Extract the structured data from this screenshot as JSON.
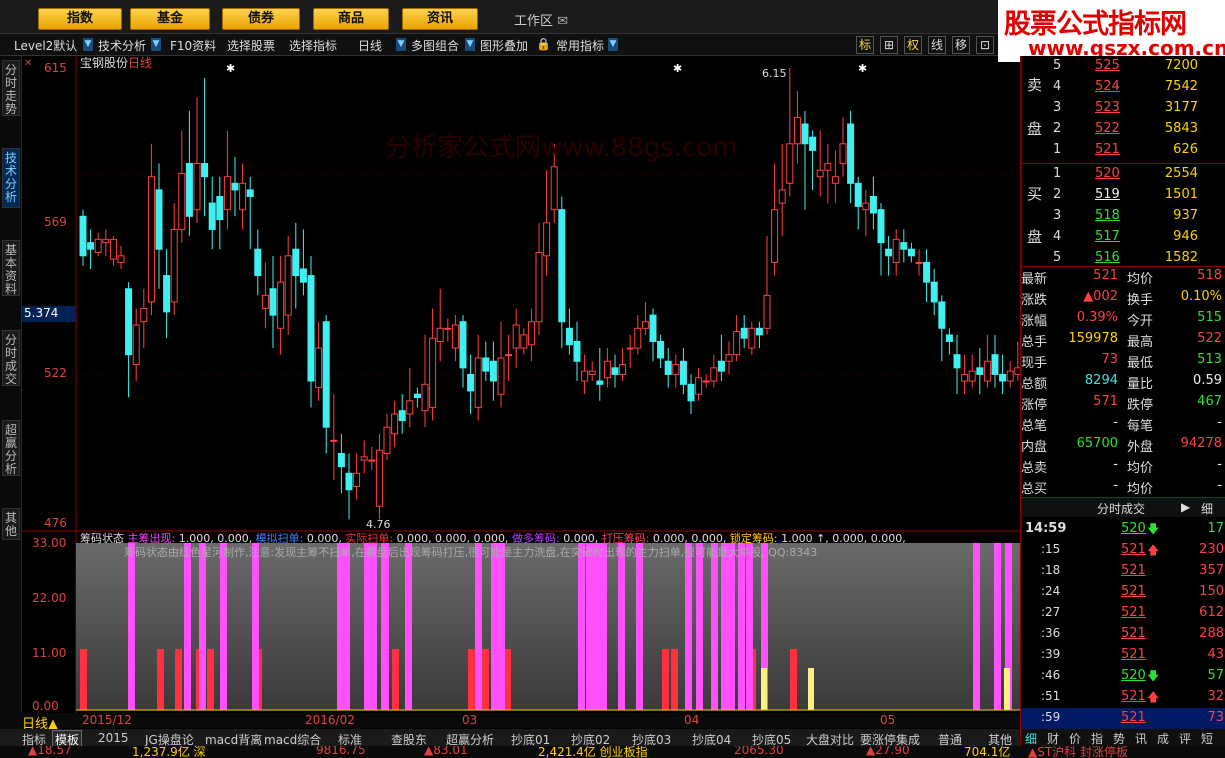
{
  "top_menu": [
    "指数",
    "基金",
    "债券",
    "商品",
    "资讯"
  ],
  "workarea_label": "工作区",
  "logo": {
    "title": "股票公式指标网",
    "url": "www.gszx.com.cn"
  },
  "toolbar": [
    "Level2默认",
    "技术分析",
    "F10资料",
    "选择股票",
    "选择指标",
    "日线",
    "多图组合",
    "图形叠加",
    "常用指标"
  ],
  "toolbar_right": [
    "标",
    "⊞",
    "权",
    "线",
    "移",
    "⊡"
  ],
  "left_tabs": [
    "分时走势",
    "技术分析",
    "基本资料",
    "分时成交",
    "超赢分析",
    "其他"
  ],
  "price_axis": {
    "ticks": [
      "615",
      "569",
      "522",
      "476"
    ],
    "current": "5.374"
  },
  "chart_title": {
    "name": "宝钢股份",
    "period": "日线"
  },
  "chart_annotations": {
    "high": "6.15",
    "low": "4.76"
  },
  "watermark": "分析家公式网www.88gs.com",
  "indicator": {
    "name": "筹码状态",
    "items": [
      {
        "label": "主筹出现:",
        "value": "1.000, 0.000,",
        "color": "#ff40ff"
      },
      {
        "label": "模拟扫单:",
        "value": "0.000,",
        "color": "#4080ff"
      },
      {
        "label": "实际扫单:",
        "value": "0.000, 0.000, 0.000,",
        "color": "#ff3030"
      },
      {
        "label": "做多筹码:",
        "value": "0.000,",
        "color": "#b040ff"
      },
      {
        "label": "打压筹码:",
        "value": "0.000, 0.000,",
        "color": "#ff4060"
      },
      {
        "label": "锁定筹码:",
        "value": "1.000 ↑, 0.000, 0.000,",
        "color": "#ffd000"
      }
    ],
    "scroll_text": "筹码状态由红色星河制作,注意:发现主筹不扫单,在横盘后出现筹码打压,很可能是主力洗盘,在突破时出现的主力扫单,很可能是大牛股, QQ:8343",
    "y_ticks": [
      "33.00",
      "22.00",
      "11.00",
      "0.00"
    ]
  },
  "period_label": "日线",
  "dates": [
    "2015/12",
    "2016/02",
    "03",
    "04",
    "05"
  ],
  "bottom_tabs": [
    "指标",
    "模板",
    "2015",
    "JG操盘论",
    "macd背离",
    "macd综合",
    "标准",
    "查股东",
    "超赢分析",
    "抄底01",
    "抄底02",
    "抄底03",
    "抄底04",
    "抄底05",
    "大盘对比",
    "要涨停集成",
    "普通",
    "其他"
  ],
  "status_bar": [
    "▲18.57",
    "1,237.9亿 深",
    "9816.75",
    "▲83.01",
    "2,421.4亿 创业板指",
    "2065.30",
    "▲27.90",
    "704.1亿",
    "▲ST沪科 封涨停板"
  ],
  "order_book": {
    "sell_label": [
      "卖",
      "盘"
    ],
    "buy_label": [
      "买",
      "盘"
    ],
    "sell": [
      {
        "level": "5",
        "price": "525",
        "vol": "7200"
      },
      {
        "level": "4",
        "price": "524",
        "vol": "7542"
      },
      {
        "level": "3",
        "price": "523",
        "vol": "3177"
      },
      {
        "level": "2",
        "price": "522",
        "vol": "5843"
      },
      {
        "level": "1",
        "price": "521",
        "vol": "626"
      }
    ],
    "buy": [
      {
        "level": "1",
        "price": "520",
        "vol": "2554"
      },
      {
        "level": "2",
        "price": "519",
        "vol": "1501"
      },
      {
        "level": "3",
        "price": "518",
        "vol": "937"
      },
      {
        "level": "4",
        "price": "517",
        "vol": "946"
      },
      {
        "level": "5",
        "price": "516",
        "vol": "1582"
      }
    ]
  },
  "quote": [
    {
      "l1": "最新",
      "v1": "521",
      "c1": "red",
      "l2": "均价",
      "v2": "518",
      "c2": "red"
    },
    {
      "l1": "涨跌",
      "v1": "▲002",
      "c1": "red",
      "l2": "换手",
      "v2": "0.10%",
      "c2": "yellow"
    },
    {
      "l1": "涨幅",
      "v1": "0.39%",
      "c1": "red",
      "l2": "今开",
      "v2": "515",
      "c2": "green"
    },
    {
      "l1": "总手",
      "v1": "159978",
      "c1": "yellow",
      "l2": "最高",
      "v2": "522",
      "c2": "red"
    },
    {
      "l1": "现手",
      "v1": "73",
      "c1": "red",
      "l2": "最低",
      "v2": "513",
      "c2": "green"
    },
    {
      "l1": "总额",
      "v1": "8294",
      "c1": "cyan",
      "l2": "量比",
      "v2": "0.59",
      "c2": "white"
    },
    {
      "l1": "涨停",
      "v1": "571",
      "c1": "red",
      "l2": "跌停",
      "v2": "467",
      "c2": "green"
    },
    {
      "l1": "总笔",
      "v1": "-",
      "c1": "white",
      "l2": "每笔",
      "v2": "-",
      "c2": "white"
    },
    {
      "l1": "内盘",
      "v1": "65700",
      "c1": "green",
      "l2": "外盘",
      "v2": "94278",
      "c2": "red"
    },
    {
      "l1": "总卖",
      "v1": "-",
      "c1": "white",
      "l2": "均价",
      "v2": "-",
      "c2": "white"
    },
    {
      "l1": "总买",
      "v1": "-",
      "c1": "white",
      "l2": "均价",
      "v2": "-",
      "c2": "white"
    }
  ],
  "trades_title": "分时成交",
  "trades_tab": "细",
  "trades": [
    {
      "time": "14:59",
      "price": "520",
      "dir": "down",
      "vol": "17"
    },
    {
      "time": ":15",
      "price": "521",
      "dir": "up",
      "vol": "230"
    },
    {
      "time": ":18",
      "price": "521",
      "dir": "",
      "vol": "357"
    },
    {
      "time": ":24",
      "price": "521",
      "dir": "",
      "vol": "150"
    },
    {
      "time": ":27",
      "price": "521",
      "dir": "",
      "vol": "612"
    },
    {
      "time": ":36",
      "price": "521",
      "dir": "",
      "vol": "288"
    },
    {
      "time": ":39",
      "price": "521",
      "dir": "",
      "vol": "43"
    },
    {
      "time": ":46",
      "price": "520",
      "dir": "down",
      "vol": "57"
    },
    {
      "time": ":51",
      "price": "521",
      "dir": "up",
      "vol": "32"
    },
    {
      "time": ":59",
      "price": "521",
      "dir": "",
      "vol": "73"
    }
  ],
  "right_bottom_tabs": [
    "细",
    "财",
    "价",
    "指",
    "势",
    "讯",
    "成",
    "评",
    "短"
  ],
  "colors": {
    "up": "#ff4040",
    "down": "#40f0f0",
    "accent": "#ffd24d",
    "frame": "#8b0000"
  },
  "chart_data": {
    "type": "candlestick",
    "title": "宝钢股份 日线",
    "ylim": [
      4.76,
      6.15
    ],
    "y_ticks": [
      6.15,
      5.69,
      5.22,
      4.76
    ],
    "x_ticks": [
      "2015/12",
      "2016/02",
      "03",
      "04",
      "05"
    ],
    "high": 6.15,
    "low": 4.76,
    "current_price_marker": 5.374,
    "candles": [
      [
        5.7,
        5.58,
        5.72,
        5.55
      ],
      [
        5.62,
        5.6,
        5.66,
        5.54
      ],
      [
        5.59,
        5.63,
        5.65,
        5.58
      ],
      [
        5.62,
        5.63,
        5.66,
        5.58
      ],
      [
        5.57,
        5.63,
        5.64,
        5.55
      ],
      [
        5.56,
        5.58,
        5.61,
        5.54
      ],
      [
        5.48,
        5.28,
        5.5,
        5.15
      ],
      [
        5.25,
        5.37,
        5.42,
        5.2
      ],
      [
        5.38,
        5.42,
        5.48,
        5.3
      ],
      [
        5.44,
        5.82,
        5.92,
        5.4
      ],
      [
        5.78,
        5.6,
        5.86,
        5.48
      ],
      [
        5.52,
        5.41,
        5.6,
        5.33
      ],
      [
        5.44,
        5.66,
        5.74,
        5.4
      ],
      [
        5.66,
        5.83,
        5.96,
        5.62
      ],
      [
        5.86,
        5.7,
        6.02,
        5.64
      ],
      [
        5.72,
        5.86,
        6.06,
        5.68
      ],
      [
        5.86,
        5.82,
        6.12,
        5.7
      ],
      [
        5.74,
        5.66,
        5.82,
        5.6
      ],
      [
        5.76,
        5.69,
        5.82,
        5.6
      ],
      [
        5.72,
        5.82,
        5.96,
        5.66
      ],
      [
        5.8,
        5.78,
        5.88,
        5.7
      ],
      [
        5.72,
        5.8,
        5.86,
        5.66
      ],
      [
        5.78,
        5.76,
        5.82,
        5.6
      ],
      [
        5.6,
        5.52,
        5.66,
        5.46
      ],
      [
        5.42,
        5.46,
        5.56,
        5.36
      ],
      [
        5.48,
        5.4,
        5.58,
        5.3
      ],
      [
        5.36,
        5.5,
        5.58,
        5.28
      ],
      [
        5.4,
        5.58,
        5.64,
        5.34
      ],
      [
        5.6,
        5.52,
        5.68,
        5.42
      ],
      [
        5.54,
        5.5,
        5.66,
        5.46
      ],
      [
        5.52,
        5.2,
        5.58,
        5.12
      ],
      [
        5.18,
        5.3,
        5.38,
        5.14
      ],
      [
        5.38,
        5.06,
        5.4,
        4.98
      ],
      [
        5.02,
        5.02,
        5.16,
        4.9
      ],
      [
        4.98,
        4.94,
        5.04,
        4.86
      ],
      [
        4.92,
        4.87,
        4.98,
        4.78
      ],
      [
        4.88,
        4.92,
        4.98,
        4.84
      ],
      [
        4.96,
        4.97,
        5.02,
        4.92
      ],
      [
        4.96,
        4.96,
        5.0,
        4.93
      ],
      [
        4.82,
        4.99,
        5.04,
        4.78
      ],
      [
        4.98,
        5.06,
        5.1,
        4.96
      ],
      [
        5.04,
        5.1,
        5.14,
        5.0
      ],
      [
        5.11,
        5.08,
        5.16,
        5.04
      ],
      [
        5.1,
        5.14,
        5.24,
        5.06
      ],
      [
        5.16,
        5.15,
        5.18,
        5.12
      ],
      [
        5.11,
        5.19,
        5.34,
        5.06
      ],
      [
        5.12,
        5.33,
        5.42,
        5.08
      ],
      [
        5.32,
        5.36,
        5.48,
        5.26
      ],
      [
        5.36,
        5.36,
        5.39,
        5.32
      ],
      [
        5.3,
        5.37,
        5.4,
        5.26
      ],
      [
        5.38,
        5.24,
        5.4,
        5.18
      ],
      [
        5.22,
        5.17,
        5.28,
        5.1
      ],
      [
        5.12,
        5.27,
        5.34,
        5.08
      ],
      [
        5.27,
        5.23,
        5.32,
        5.2
      ],
      [
        5.26,
        5.2,
        5.32,
        5.14
      ],
      [
        5.16,
        5.27,
        5.38,
        5.12
      ],
      [
        5.28,
        5.28,
        5.34,
        5.2
      ],
      [
        5.3,
        5.37,
        5.42,
        5.24
      ],
      [
        5.3,
        5.34,
        5.36,
        5.28
      ],
      [
        5.31,
        5.38,
        5.42,
        5.26
      ],
      [
        5.38,
        5.59,
        5.68,
        5.34
      ],
      [
        5.58,
        5.68,
        5.84,
        5.52
      ],
      [
        5.72,
        5.85,
        5.92,
        5.68
      ],
      [
        5.72,
        5.38,
        5.76,
        5.3
      ],
      [
        5.36,
        5.31,
        5.42,
        5.28
      ],
      [
        5.32,
        5.26,
        5.38,
        5.2
      ],
      [
        5.2,
        5.23,
        5.28,
        5.16
      ],
      [
        5.22,
        5.23,
        5.26,
        5.2
      ],
      [
        5.2,
        5.19,
        5.3,
        5.14
      ],
      [
        5.21,
        5.26,
        5.3,
        5.18
      ],
      [
        5.24,
        5.22,
        5.28,
        5.18
      ],
      [
        5.22,
        5.25,
        5.3,
        5.2
      ],
      [
        5.3,
        5.3,
        5.34,
        5.24
      ],
      [
        5.3,
        5.36,
        5.4,
        5.28
      ],
      [
        5.36,
        5.38,
        5.44,
        5.34
      ],
      [
        5.4,
        5.32,
        5.42,
        5.26
      ],
      [
        5.32,
        5.27,
        5.34,
        5.24
      ],
      [
        5.26,
        5.22,
        5.3,
        5.18
      ],
      [
        5.22,
        5.25,
        5.28,
        5.18
      ],
      [
        5.26,
        5.19,
        5.3,
        5.16
      ],
      [
        5.19,
        5.14,
        5.22,
        5.1
      ],
      [
        5.16,
        5.21,
        5.24,
        5.14
      ],
      [
        5.2,
        5.2,
        5.22,
        5.18
      ],
      [
        5.2,
        5.24,
        5.28,
        5.18
      ],
      [
        5.26,
        5.23,
        5.34,
        5.2
      ],
      [
        5.26,
        5.28,
        5.32,
        5.22
      ],
      [
        5.28,
        5.35,
        5.4,
        5.26
      ],
      [
        5.36,
        5.33,
        5.4,
        5.3
      ],
      [
        5.3,
        5.36,
        5.38,
        5.28
      ],
      [
        5.36,
        5.34,
        5.38,
        5.3
      ],
      [
        5.36,
        5.46,
        5.64,
        5.34
      ],
      [
        5.56,
        5.72,
        5.86,
        5.52
      ],
      [
        5.74,
        5.78,
        5.92,
        5.64
      ],
      [
        5.8,
        5.92,
        6.15,
        5.76
      ],
      [
        5.92,
        6.0,
        6.08,
        5.86
      ],
      [
        5.98,
        5.92,
        6.02,
        5.72
      ],
      [
        5.94,
        5.9,
        5.96,
        5.78
      ],
      [
        5.82,
        5.84,
        5.96,
        5.76
      ],
      [
        5.84,
        5.86,
        5.92,
        5.74
      ],
      [
        5.8,
        5.82,
        5.9,
        5.74
      ],
      [
        5.86,
        5.92,
        6.0,
        5.82
      ],
      [
        5.98,
        5.8,
        6.02,
        5.74
      ],
      [
        5.8,
        5.73,
        5.82,
        5.66
      ],
      [
        5.72,
        5.74,
        5.78,
        5.64
      ],
      [
        5.76,
        5.71,
        5.82,
        5.66
      ],
      [
        5.72,
        5.62,
        5.74,
        5.52
      ],
      [
        5.6,
        5.58,
        5.64,
        5.52
      ],
      [
        5.56,
        5.63,
        5.66,
        5.52
      ],
      [
        5.62,
        5.6,
        5.66,
        5.56
      ],
      [
        5.6,
        5.58,
        5.62,
        5.56
      ],
      [
        5.56,
        5.56,
        5.6,
        5.52
      ],
      [
        5.56,
        5.5,
        5.6,
        5.44
      ],
      [
        5.5,
        5.44,
        5.54,
        5.4
      ],
      [
        5.44,
        5.36,
        5.46,
        5.26
      ],
      [
        5.34,
        5.32,
        5.36,
        5.28
      ],
      [
        5.28,
        5.24,
        5.34,
        5.16
      ],
      [
        5.2,
        5.22,
        5.28,
        5.16
      ],
      [
        5.2,
        5.23,
        5.28,
        5.18
      ],
      [
        5.24,
        5.22,
        5.3,
        5.16
      ],
      [
        5.2,
        5.26,
        5.34,
        5.18
      ],
      [
        5.28,
        5.22,
        5.34,
        5.18
      ],
      [
        5.22,
        5.2,
        5.28,
        5.16
      ],
      [
        5.2,
        5.23,
        5.26,
        5.18
      ],
      [
        5.22,
        5.24,
        5.32,
        5.2
      ],
      [
        5.24,
        5.23,
        5.28,
        5.2
      ],
      [
        5.22,
        5.21,
        5.26,
        5.16
      ],
      [
        5.2,
        5.2,
        5.24,
        5.16
      ],
      [
        5.2,
        5.21,
        5.24,
        5.18
      ]
    ]
  }
}
